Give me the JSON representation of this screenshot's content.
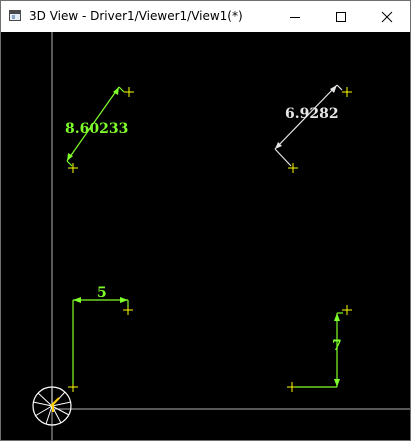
{
  "window": {
    "title": "3D View - Driver1/Viewer1/View1(*)",
    "controls": {
      "minimize": "minimize",
      "maximize": "maximize",
      "close": "close"
    }
  },
  "viewport": {
    "background": "#000000",
    "dimensions": [
      {
        "name": "dim-8-60233",
        "value": "8.60233",
        "color": "#7fff2a"
      },
      {
        "name": "dim-6-9282",
        "value": "6.9282",
        "color": "#e6e6e6"
      },
      {
        "name": "dim-5",
        "value": "5",
        "color": "#7fff2a"
      },
      {
        "name": "dim-7",
        "value": "7",
        "color": "#7fff2a"
      }
    ],
    "point_color": "#ffff00",
    "axis_color": "#b0b0b0"
  }
}
